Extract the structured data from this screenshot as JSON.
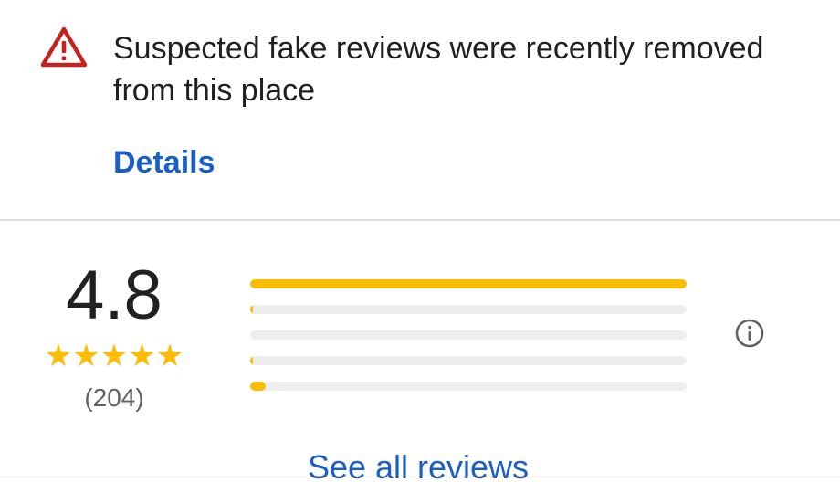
{
  "warning": {
    "icon": "warning-triangle-icon",
    "icon_color": "#c5221f",
    "text": "Suspected fake reviews were recently removed from this place",
    "link_label": "Details"
  },
  "rating_summary": {
    "average": "4.8",
    "stars": "★★★★★",
    "count": "(204)",
    "star_color": "#fbbc04",
    "distribution": [
      {
        "stars": 5,
        "fraction": 1.0
      },
      {
        "stars": 4,
        "fraction": 0.006
      },
      {
        "stars": 3,
        "fraction": 0.0
      },
      {
        "stars": 2,
        "fraction": 0.006
      },
      {
        "stars": 1,
        "fraction": 0.035
      }
    ],
    "info_icon": "info-icon"
  },
  "see_all_label": "See all reviews",
  "link_color": "#1a5fc7"
}
